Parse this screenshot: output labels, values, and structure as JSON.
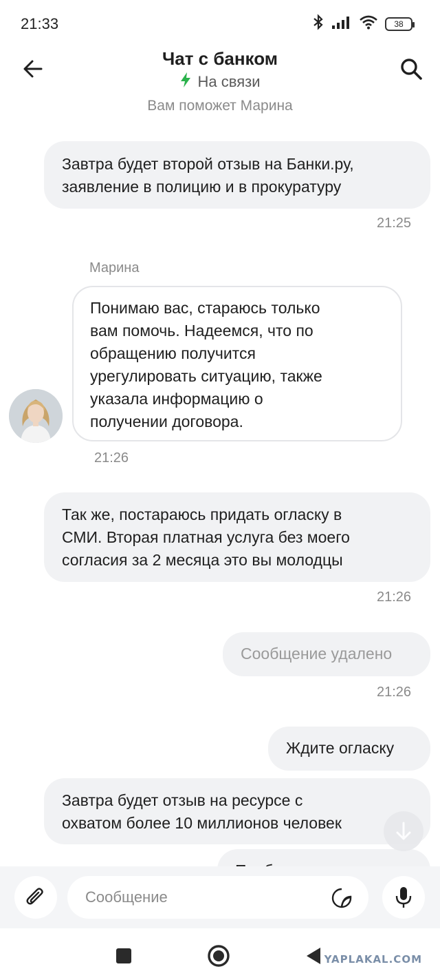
{
  "status_bar": {
    "time": "21:33",
    "battery": "38",
    "icons": [
      "bluetooth-icon",
      "signal-icon",
      "wifi-icon",
      "battery-icon"
    ]
  },
  "header": {
    "title": "Чат с банком",
    "status": "На связи",
    "status_color": "#2bb24c",
    "subtitle": "Вам поможет Марина"
  },
  "messages": [
    {
      "from": "user",
      "lines": [
        "Завтра будет второй отзыв на Банки.ру,",
        "заявление в полицию и в прокуратуру"
      ],
      "time": "21:25"
    },
    {
      "from": "operator",
      "sender": "Марина",
      "lines": [
        "Понимаю вас, стараюсь только",
        "вам помочь. Надеемся, что по",
        "обращению получится",
        "урегулировать ситуацию, также",
        "указала информацию о",
        "получении договора."
      ],
      "time": "21:26"
    },
    {
      "from": "user",
      "lines": [
        "Так же, постараюсь придать огласку в",
        "СМИ. Вторая платная услуга без моего",
        "согласия за 2 месяца это вы молодцы"
      ],
      "time": "21:26"
    },
    {
      "from": "user",
      "deleted": true,
      "lines": [
        "Сообщение удалено"
      ],
      "time": "21:26"
    },
    {
      "from": "user",
      "lines": [
        "Ждите огласку"
      ]
    },
    {
      "from": "user",
      "lines": [
        "Завтра будет отзыв на ресурсе с",
        "охватом более 10 миллионов человек"
      ]
    },
    {
      "from": "user",
      "lines": [
        "Пообещ"
      ]
    }
  ],
  "composer": {
    "placeholder": "Сообщение"
  },
  "watermark": "YAPLAKAL.COM",
  "colors": {
    "bubble": "#f1f2f4",
    "accent": "#2bb24c"
  }
}
